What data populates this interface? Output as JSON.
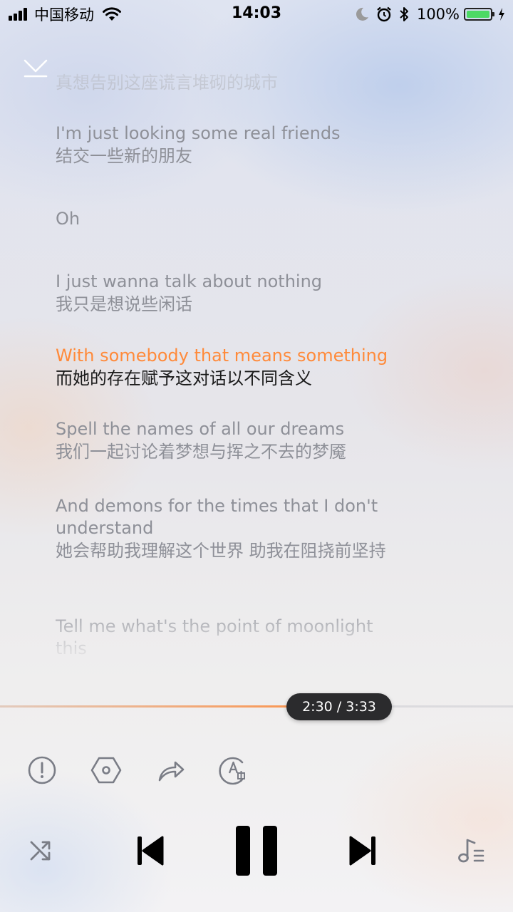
{
  "status_bar": {
    "carrier": "中国移动",
    "time": "14:03",
    "battery": "100%",
    "icons": [
      "signal-icon",
      "wifi-icon",
      "moon-icon",
      "alarm-icon",
      "bluetooth-icon",
      "battery-icon",
      "charging-icon"
    ]
  },
  "lyrics": {
    "lines": [
      {
        "en": "",
        "zh": "真想告别这座谎言堆砌的城市"
      },
      {
        "en": "I'm just looking some real friends",
        "zh": "结交一些新的朋友"
      },
      {
        "en": "Oh",
        "zh": ""
      },
      {
        "en": "I just wanna talk about nothing",
        "zh": "我只是想说些闲话"
      },
      {
        "en": "With somebody that means something",
        "zh": "而她的存在赋予这对话以不同含义"
      },
      {
        "en": "Spell the names of all our dreams",
        "zh": "我们一起讨论着梦想与挥之不去的梦魇"
      },
      {
        "en": "And demons for the times that I don't understand",
        "zh": "她会帮助我理解这个世界 助我在阻挠前坚持"
      },
      {
        "en": "Tell me what's the point of moonlight this",
        "zh": ""
      }
    ],
    "current_index": 4
  },
  "player": {
    "elapsed": "2:30",
    "duration": "3:33",
    "time_display": "2:30 / 3:33",
    "progress": 0.704
  },
  "actions": [
    "info-icon",
    "hexagon-icon",
    "share-icon",
    "translate-icon"
  ],
  "controls": [
    "shuffle-icon",
    "previous-icon",
    "pause-icon",
    "next-icon",
    "playlist-icon"
  ],
  "colors": {
    "accent": "#ff8a3a",
    "lyric_inactive": "#8e9098",
    "lyric_current_translation": "#1a1a1a",
    "icon": "#7a7d86",
    "pill_bg": "#2b2b2d"
  }
}
